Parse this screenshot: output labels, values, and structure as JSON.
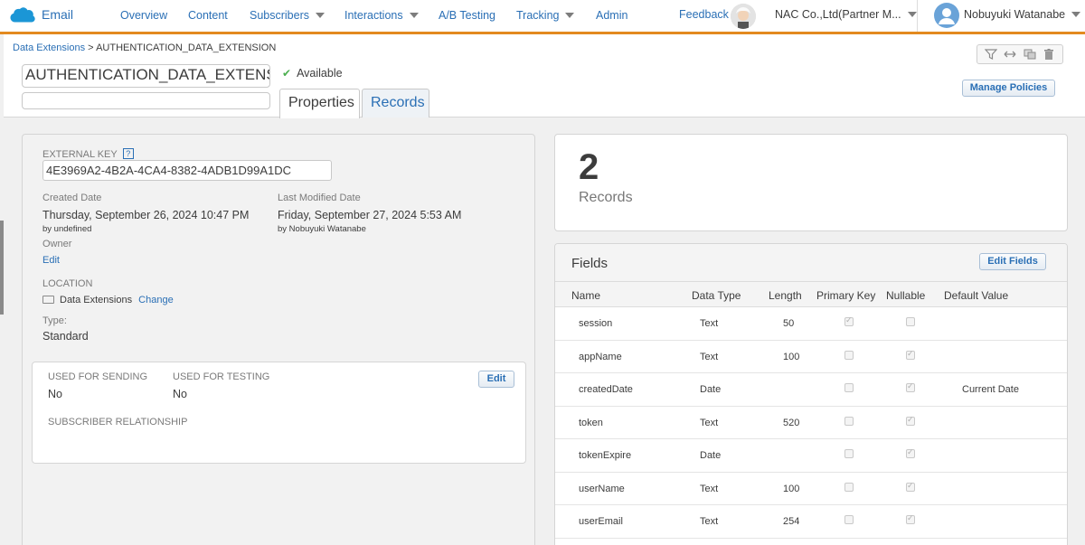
{
  "topnav": {
    "app_name": "Email",
    "items": [
      {
        "label": "Overview",
        "dropdown": false
      },
      {
        "label": "Content",
        "dropdown": false
      },
      {
        "label": "Subscribers",
        "dropdown": true
      },
      {
        "label": "Interactions",
        "dropdown": true
      },
      {
        "label": "A/B Testing",
        "dropdown": false
      },
      {
        "label": "Tracking",
        "dropdown": true
      },
      {
        "label": "Admin",
        "dropdown": false
      }
    ],
    "feedback": "Feedback",
    "org": "NAC Co.,Ltd(Partner M...",
    "user": "Nobuyuki Watanabe"
  },
  "header": {
    "breadcrumb_root": "Data Extensions",
    "breadcrumb_sep": ">",
    "breadcrumb_current": "AUTHENTICATION_DATA_EXTENSION",
    "name_value": "AUTHENTICATION_DATA_EXTENSI",
    "description_value": "",
    "status": "Available",
    "tabs": [
      "Properties",
      "Records"
    ],
    "manage_policies": "Manage Policies"
  },
  "properties": {
    "external_key_label": "EXTERNAL KEY",
    "help": "?",
    "external_key": "4E3969A2-4B2A-4CA4-8382-4ADB1D99A1DC",
    "created_label": "Created Date",
    "created_value": "Thursday, September 26, 2024 10:47 PM",
    "created_by": "by undefined",
    "modified_label": "Last Modified Date",
    "modified_value": "Friday, September 27, 2024 5:53 AM",
    "modified_by": "by Nobuyuki Watanabe",
    "owner_label": "Owner",
    "owner_edit": "Edit",
    "location_label": "LOCATION",
    "location_value": "Data Extensions",
    "location_change": "Change",
    "type_label": "Type:",
    "type_value": "Standard",
    "used_sending_label": "USED FOR SENDING",
    "used_sending_value": "No",
    "used_testing_label": "USED FOR TESTING",
    "used_testing_value": "No",
    "subscriber_rel_label": "SUBSCRIBER RELATIONSHIP",
    "edit": "Edit"
  },
  "records": {
    "count": "2",
    "label": "Records"
  },
  "fields": {
    "title": "Fields",
    "edit_fields": "Edit Fields",
    "columns": [
      "Name",
      "Data Type",
      "Length",
      "Primary Key",
      "Nullable",
      "Default Value"
    ],
    "rows": [
      {
        "name": "session",
        "type": "Text",
        "length": "50",
        "pk": true,
        "nullable": false,
        "default": ""
      },
      {
        "name": "appName",
        "type": "Text",
        "length": "100",
        "pk": false,
        "nullable": true,
        "default": ""
      },
      {
        "name": "createdDate",
        "type": "Date",
        "length": "",
        "pk": false,
        "nullable": true,
        "default": "Current Date"
      },
      {
        "name": "token",
        "type": "Text",
        "length": "520",
        "pk": false,
        "nullable": true,
        "default": ""
      },
      {
        "name": "tokenExpire",
        "type": "Date",
        "length": "",
        "pk": false,
        "nullable": true,
        "default": ""
      },
      {
        "name": "userName",
        "type": "Text",
        "length": "100",
        "pk": false,
        "nullable": true,
        "default": ""
      },
      {
        "name": "userEmail",
        "type": "Text",
        "length": "254",
        "pk": false,
        "nullable": true,
        "default": ""
      }
    ]
  },
  "colors": {
    "accent_bar": "#e38a1f",
    "link": "#2a6fb5",
    "check_green": "#4caf50"
  }
}
